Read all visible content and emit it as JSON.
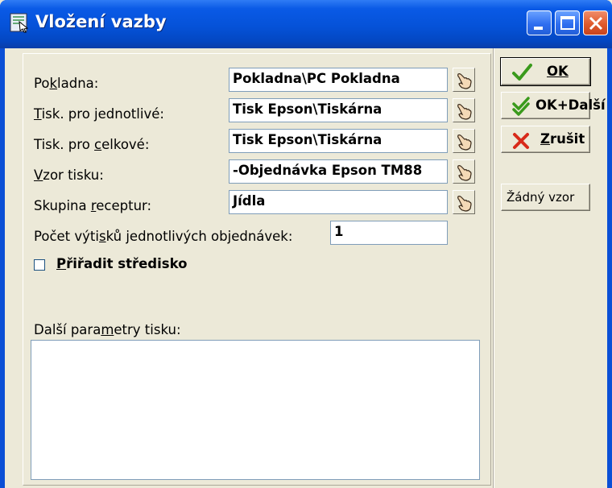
{
  "window": {
    "title": "Vložení vazby"
  },
  "form": {
    "pokladna": {
      "label": "Pokladna:",
      "value": "Pokladna\\PC Pokladna"
    },
    "tisk_jednotlive": {
      "label": "Tisk. pro jednotlivé:",
      "value": "Tisk Epson\\Tiskárna"
    },
    "tisk_celkove": {
      "label": "Tisk. pro celkové:",
      "value": "Tisk Epson\\Tiskárna"
    },
    "vzor_tisku": {
      "label": "Vzor tisku:",
      "value": "-Objednávka Epson TM88"
    },
    "skupina_receptur": {
      "label": "Skupina receptur:",
      "value": "Jídla"
    },
    "pocet_vytisku": {
      "label": "Počet výtisků jednotlivých objednávek:",
      "value": "1"
    },
    "priradit_stredisko": {
      "label": "Přiřadit středisko",
      "checked": false
    },
    "dalsi_parametry": {
      "label": "Další parametry tisku:",
      "value": ""
    }
  },
  "buttons": {
    "ok": "OK",
    "ok_dalsi": "OK+Další",
    "zrusit": "Zrušit",
    "zadny_vzor": "Žádný vzor"
  },
  "icons": {
    "title": "document-icon",
    "hand_picker": "hand-pointer-icon",
    "ok": "checkmark-icon",
    "ok_dalsi": "double-checkmark-icon",
    "zrusit": "red-x-icon"
  },
  "colors": {
    "titlebar": "#0552d8",
    "dialog_bg": "#ece9d8",
    "close_button": "#e05a2d",
    "ok_check": "#3a9a1c",
    "cancel_x": "#d82a1a"
  }
}
